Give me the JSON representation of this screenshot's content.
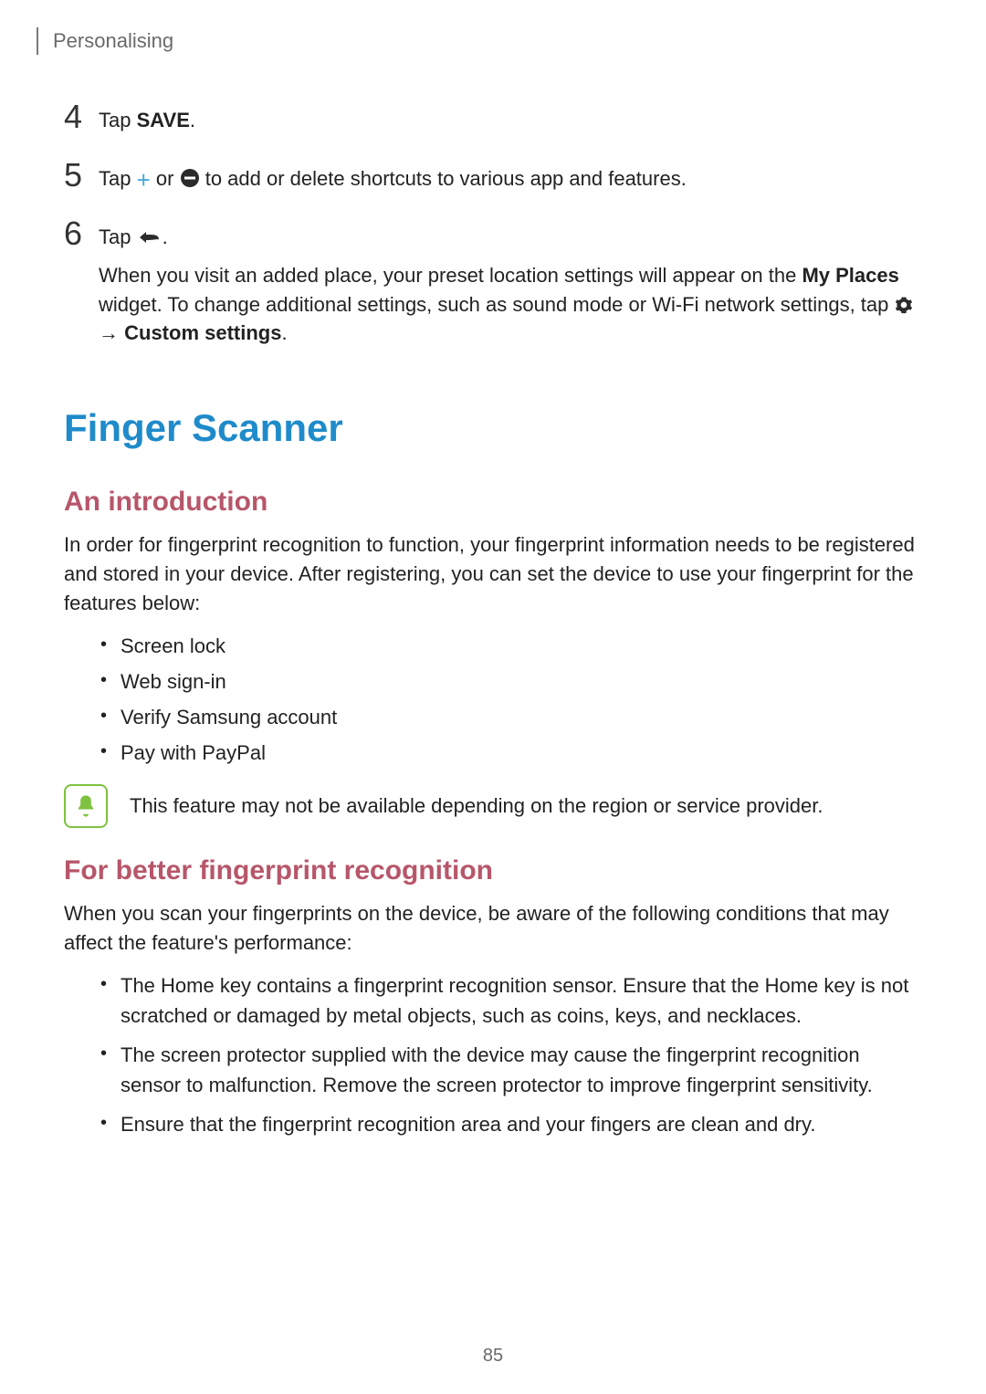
{
  "header": {
    "section": "Personalising"
  },
  "steps": {
    "s4": {
      "num": "4",
      "prefix": "Tap ",
      "bold": "SAVE",
      "suffix": "."
    },
    "s5": {
      "num": "5",
      "prefix": "Tap ",
      "mid": " or ",
      "suffix": " to add or delete shortcuts to various app and features."
    },
    "s6": {
      "num": "6",
      "line1_prefix": "Tap ",
      "line1_suffix": ".",
      "line2a": "When you visit an added place, your preset location settings will appear on the ",
      "line2b_bold": "My Places",
      "line2c": " widget. To change additional settings, such as sound mode or Wi-Fi network settings, tap ",
      "line2d_arrow": " → ",
      "line2e_bold": "Custom settings",
      "line2f": "."
    }
  },
  "h1": "Finger Scanner",
  "intro": {
    "heading": "An introduction",
    "para": "In order for fingerprint recognition to function, your fingerprint information needs to be registered and stored in your device. After registering, you can set the device to use your fingerprint for the features below:",
    "bullets": [
      "Screen lock",
      "Web sign-in",
      "Verify Samsung account",
      "Pay with PayPal"
    ],
    "note": "This feature may not be available depending on the region or service provider."
  },
  "better": {
    "heading": "For better fingerprint recognition",
    "para": "When you scan your fingerprints on the device, be aware of the following conditions that may affect the feature's performance:",
    "bullets": [
      "The Home key contains a fingerprint recognition sensor. Ensure that the Home key is not scratched or damaged by metal objects, such as coins, keys, and necklaces.",
      "The screen protector supplied with the device may cause the fingerprint recognition sensor to malfunction. Remove the screen protector to improve fingerprint sensitivity.",
      "Ensure that the fingerprint recognition area and your fingers are clean and dry."
    ]
  },
  "page_number": "85"
}
